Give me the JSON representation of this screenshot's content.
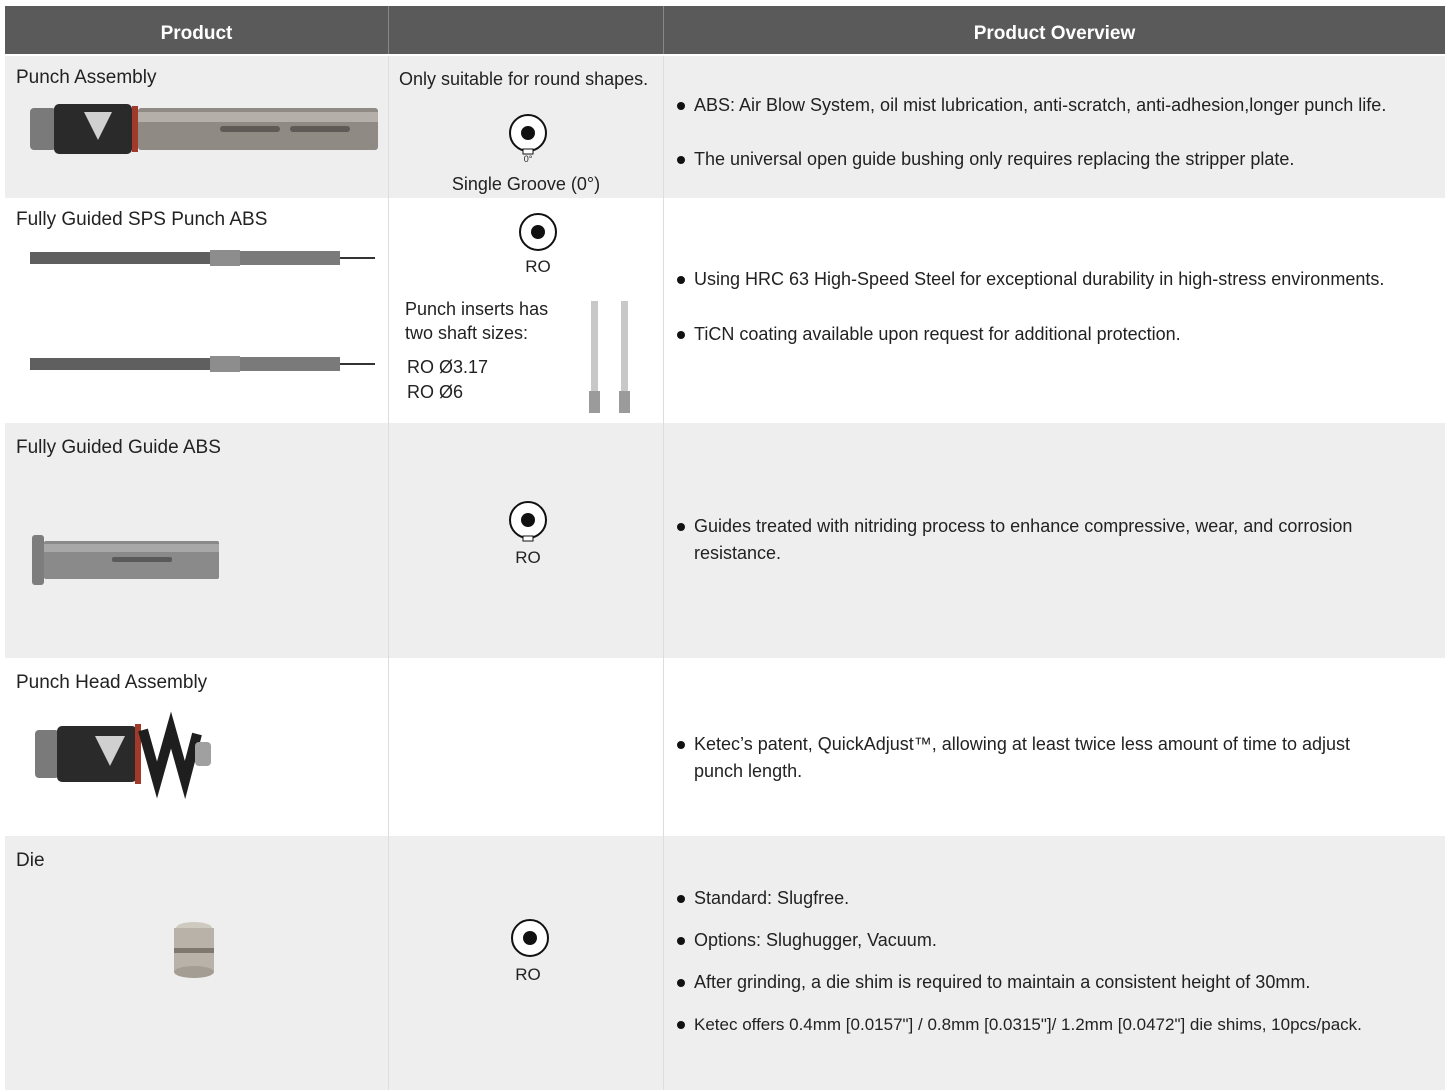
{
  "header": {
    "product": "Product",
    "blank": "",
    "overview": "Product Overview"
  },
  "rows": [
    {
      "name": "Punch Assembly",
      "shape_note": "Only suitable for round shapes.",
      "groove_tick": "0°",
      "groove_label": "Single Groove (0°)",
      "bullets": [
        "ABS: Air Blow System, oil mist lubrication, anti-scratch, anti-adhesion,longer punch life.",
        "The universal open guide bushing only requires replacing the stripper plate."
      ]
    },
    {
      "name": "Fully Guided SPS Punch ABS",
      "shape_label": "RO",
      "inserts_text": [
        "Punch inserts has",
        "two shaft sizes:"
      ],
      "sizes": [
        "RO Ø3.17",
        "RO Ø6"
      ],
      "bullets": [
        "Using HRC 63 High-Speed Steel for exceptional durability in high-stress environments.",
        "TiCN coating available upon request for additional protection."
      ]
    },
    {
      "name": "Fully Guided Guide ABS",
      "shape_label": "RO",
      "bullets": [
        "Guides treated with nitriding process to enhance compressive, wear, and corrosion resistance."
      ]
    },
    {
      "name": "Punch Head Assembly",
      "bullets": [
        "Ketec’s patent, QuickAdjust™,  allowing at least twice less amount of time to adjust punch length."
      ]
    },
    {
      "name": "Die",
      "shape_label": "RO",
      "bullets": [
        "Standard: Slugfree.",
        "Options: Slughugger, Vacuum.",
        "After grinding, a die shim is required to maintain a consistent height of 30mm.",
        "Ketec offers 0.4mm [0.0157\"] / 0.8mm [0.0315\"]/ 1.2mm [0.0472\"] die shims, 10pcs/pack."
      ]
    }
  ]
}
